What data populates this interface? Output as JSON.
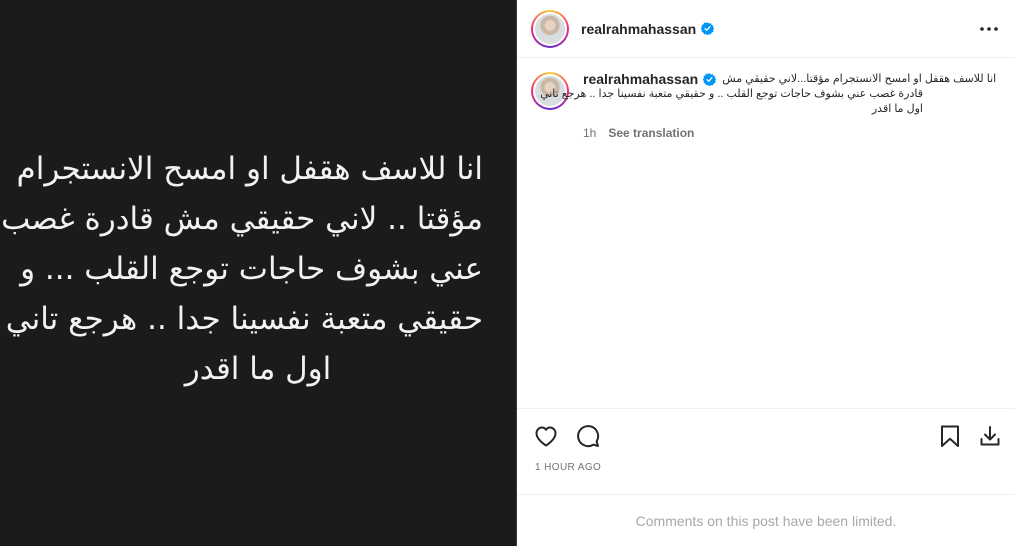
{
  "media": {
    "lines": [
      "انا للاسف هقفل او امسح الانستجرام",
      "مؤقتا .. لاني حقيقي مش قادرة غصب",
      "عني بشوف حاجات توجع القلب ... و",
      "حقيقي متعبة نفسينا جدا .. هرجع تاني",
      "اول ما اقدر"
    ]
  },
  "header": {
    "username": "realrahmahassan",
    "more_icon": "more-horizontal-icon"
  },
  "caption": {
    "username": "realrahmahassan",
    "line1": "انا للاسف هقفل او امسح الانستجرام مؤقتا...لاني حقيقي مش",
    "line2": "قادرة غصب عني بشوف حاجات توجع القلب .. و حقيقي متعبة نفسينا جدا .. هرجع تاني",
    "line3": "اول ما اقدر",
    "time": "1h",
    "see_translation": "See translation"
  },
  "actions": {
    "like_icon": "heart-icon",
    "comment_icon": "comment-icon",
    "save_icon": "bookmark-icon",
    "download_icon": "download-icon"
  },
  "timestamp": "1 HOUR AGO",
  "comments_notice": "Comments on this post have been limited.",
  "colors": {
    "verified": "#0095f6",
    "media_bg": "#1b1b1b",
    "muted": "#737373"
  }
}
